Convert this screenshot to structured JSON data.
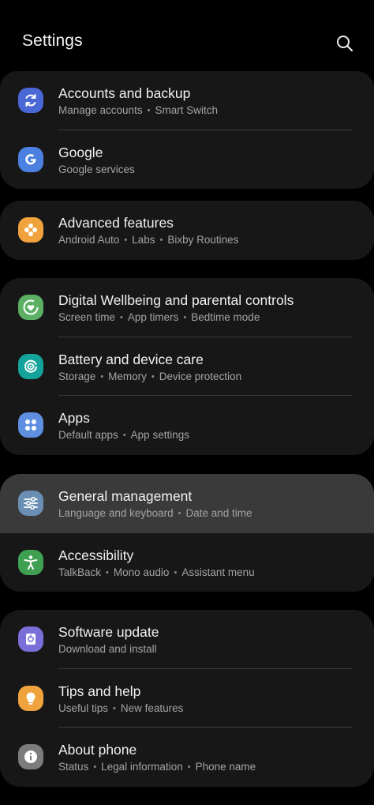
{
  "header": {
    "title": "Settings",
    "search_icon": "search-icon"
  },
  "colors": {
    "background": "#000000",
    "card": "#171717",
    "highlight": "#3a3a3a"
  },
  "groups": [
    {
      "items": [
        {
          "title": "Accounts and backup",
          "subtitle": [
            "Manage accounts",
            "Smart Switch"
          ],
          "icon": "sync-icon",
          "icon_color": "#4a67d6"
        },
        {
          "title": "Google",
          "subtitle": [
            "Google services"
          ],
          "icon": "google-g-icon",
          "icon_color": "#4c80e0"
        }
      ]
    },
    {
      "items": [
        {
          "title": "Advanced features",
          "subtitle": [
            "Android Auto",
            "Labs",
            "Bixby Routines"
          ],
          "icon": "flower-gear-icon",
          "icon_color": "#f0a33c"
        }
      ]
    },
    {
      "items": [
        {
          "title": "Digital Wellbeing and parental controls",
          "subtitle": [
            "Screen time",
            "App timers",
            "Bedtime mode"
          ],
          "icon": "heart-circle-icon",
          "icon_color": "#5bb064"
        },
        {
          "title": "Battery and device care",
          "subtitle": [
            "Storage",
            "Memory",
            "Device protection"
          ],
          "icon": "device-care-icon",
          "icon_color": "#13a39a"
        },
        {
          "title": "Apps",
          "subtitle": [
            "Default apps",
            "App settings"
          ],
          "icon": "apps-grid-icon",
          "icon_color": "#5f8fe0"
        }
      ]
    },
    {
      "items": [
        {
          "title": "General management",
          "subtitle": [
            "Language and keyboard",
            "Date and time"
          ],
          "icon": "sliders-icon",
          "icon_color": "#6b8fb4",
          "highlighted": true
        },
        {
          "title": "Accessibility",
          "subtitle": [
            "TalkBack",
            "Mono audio",
            "Assistant menu"
          ],
          "icon": "accessibility-person-icon",
          "icon_color": "#3fa052"
        }
      ]
    },
    {
      "items": [
        {
          "title": "Software update",
          "subtitle": [
            "Download and install"
          ],
          "icon": "software-update-icon",
          "icon_color": "#7a6fd8"
        },
        {
          "title": "Tips and help",
          "subtitle": [
            "Useful tips",
            "New features"
          ],
          "icon": "lightbulb-icon",
          "icon_color": "#f0a33c"
        },
        {
          "title": "About phone",
          "subtitle": [
            "Status",
            "Legal information",
            "Phone name"
          ],
          "icon": "info-icon",
          "icon_color": "#7c7c7c"
        }
      ]
    }
  ]
}
